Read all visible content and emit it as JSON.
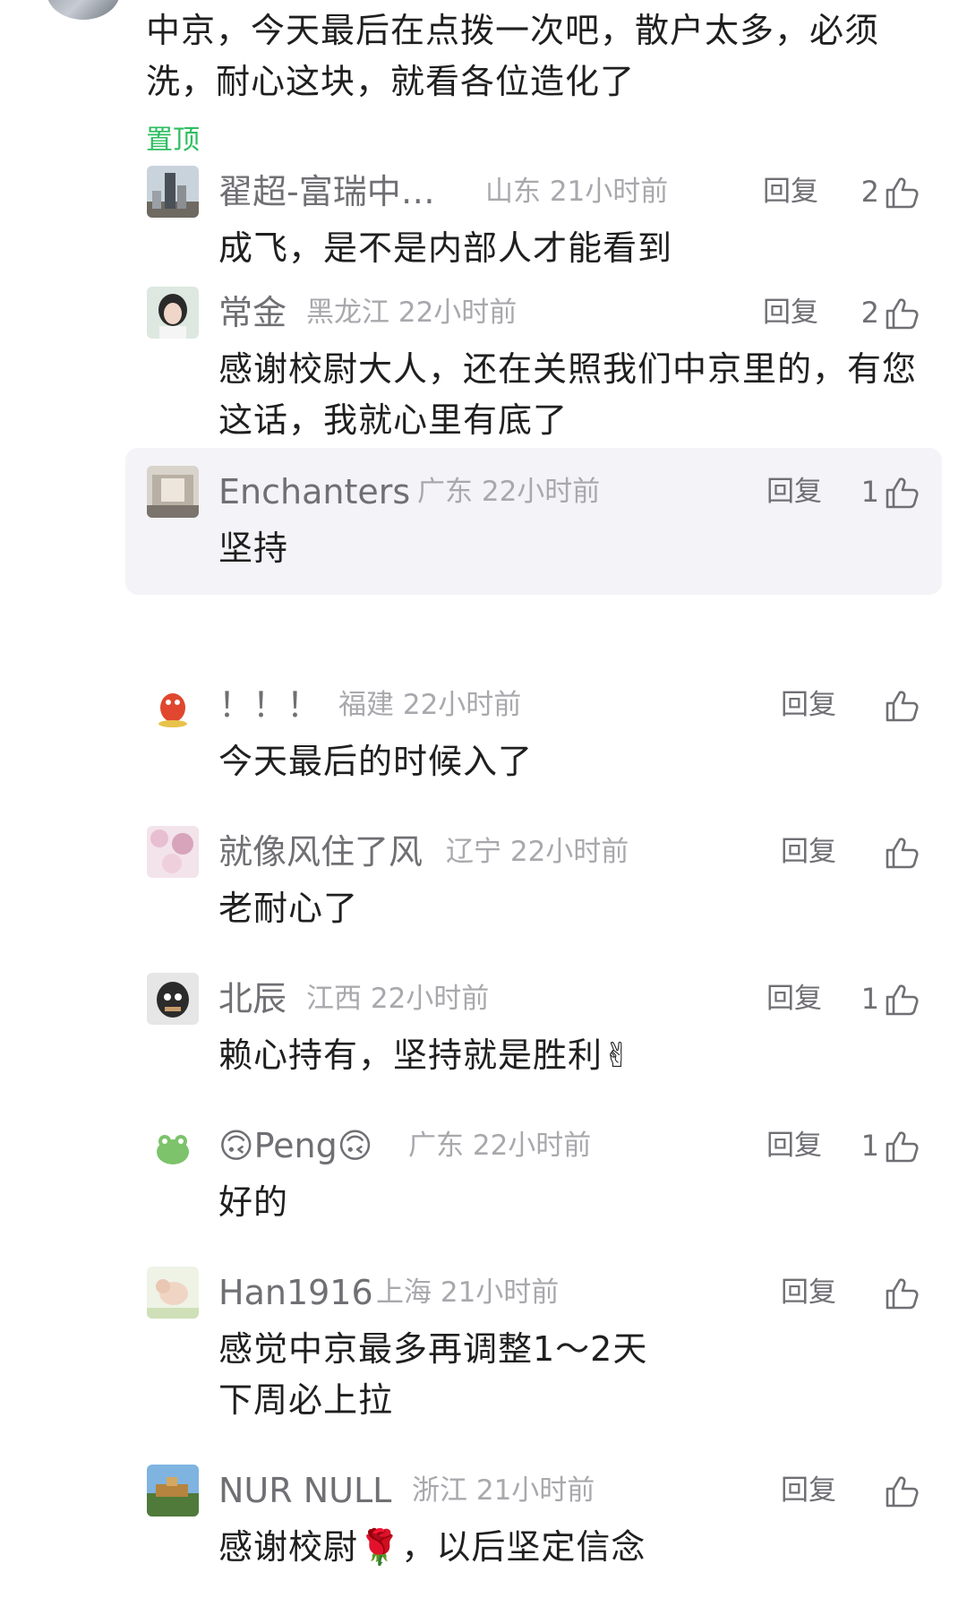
{
  "post": {
    "text": "中京，今天最后在点拨一次吧，散户太多，必须洗，耐心这块，就看各位造化了",
    "pinned_label": "置顶"
  },
  "reply_label": "回复",
  "colors": {
    "pinned": "#2dbe60",
    "highlight_bg": "#f4f3f7"
  },
  "comments": [
    {
      "name": "翟超-富瑞中…",
      "location": "山东",
      "time": "21小时前",
      "likes": "2",
      "text": "成飞，是不是内部人才能看到"
    },
    {
      "name": "常金",
      "location": "黑龙江",
      "time": "22小时前",
      "likes": "2",
      "text": "感谢校尉大人，还在关照我们中京里的，有您这话，我就心里有底了"
    },
    {
      "name": "Enchanters",
      "location": "广东",
      "time": "22小时前",
      "likes": "1",
      "text": "坚持"
    },
    {
      "name": "！！！",
      "location": "福建",
      "time": "22小时前",
      "likes": "",
      "text": "今天最后的时候入了"
    },
    {
      "name": "就像风住了风",
      "location": "辽宁",
      "time": "22小时前",
      "likes": "",
      "text": "老耐心了"
    },
    {
      "name": "北辰",
      "location": "江西",
      "time": "22小时前",
      "likes": "1",
      "text": "赖心持有，坚持就是胜利✌"
    },
    {
      "name": "🙃Peng🙃",
      "location": "广东",
      "time": "22小时前",
      "likes": "1",
      "text": "好的"
    },
    {
      "name": "Han1916",
      "location": "上海",
      "time": "21小时前",
      "likes": "",
      "text": "感觉中京最多再调整1～2天",
      "text2": "下周必上拉"
    },
    {
      "name": "NUR NULL",
      "location": "浙江",
      "time": "21小时前",
      "likes": "",
      "text": "感谢校尉🌹，以后坚定信念"
    }
  ]
}
